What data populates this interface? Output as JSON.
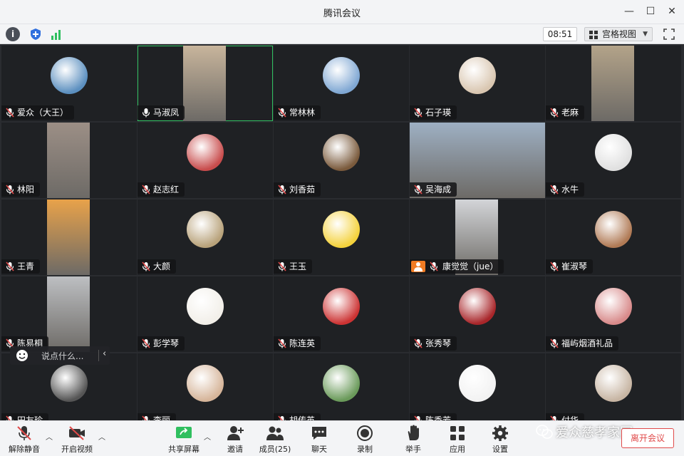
{
  "window": {
    "title": "腾讯会议"
  },
  "toolbar": {
    "time": "08:51",
    "view_label": "宫格视图"
  },
  "tiles": [
    {
      "name": "爱众（大王）"
    },
    {
      "name": "马淑凤"
    },
    {
      "name": "常林林"
    },
    {
      "name": "石子瑛"
    },
    {
      "name": "老麻"
    },
    {
      "name": "林阳"
    },
    {
      "name": "赵志红"
    },
    {
      "name": "刘香茹"
    },
    {
      "name": "吴海成"
    },
    {
      "name": "水牛"
    },
    {
      "name": "王青"
    },
    {
      "name": "大颜"
    },
    {
      "name": "王玉"
    },
    {
      "name": "康觉觉（jue）"
    },
    {
      "name": "崔淑琴"
    },
    {
      "name": "陈易桐"
    },
    {
      "name": "彭学琴"
    },
    {
      "name": "陈连英"
    },
    {
      "name": "张秀琴"
    },
    {
      "name": "福屿烟酒礼品"
    },
    {
      "name": "田友珍"
    },
    {
      "name": "李丽"
    },
    {
      "name": "胡传英"
    },
    {
      "name": "陈秀芳"
    },
    {
      "name": "付华"
    }
  ],
  "chat": {
    "placeholder": "说点什么..."
  },
  "bottombar": {
    "unmute": "解除静音",
    "video": "开启视频",
    "share": "共享屏幕",
    "invite": "邀请",
    "members": "成员(25)",
    "chat": "聊天",
    "record": "录制",
    "raise_hand": "举手",
    "apps": "应用",
    "settings": "设置",
    "leave": "离开会议"
  },
  "watermark": {
    "text": "爱众慈孝家园"
  },
  "colors": {
    "accent_green": "#2fbf5f",
    "leave_red": "#e04a4a",
    "host_orange": "#f07b23",
    "tile_bg": "#1f2124"
  }
}
